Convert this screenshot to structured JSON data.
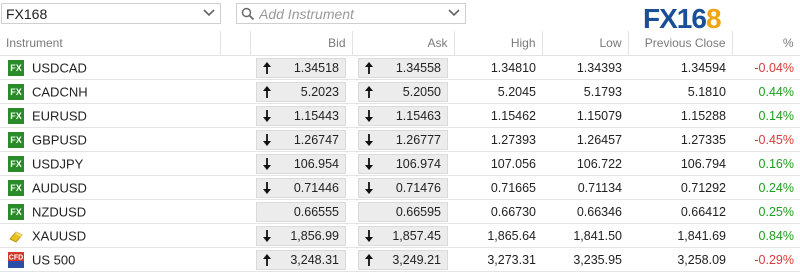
{
  "header": {
    "watchlist": "FX168",
    "add_placeholder": "Add Instrument",
    "logo_main": "FX16",
    "logo_accent": "8"
  },
  "columns": {
    "instrument": "Instrument",
    "bid": "Bid",
    "ask": "Ask",
    "high": "High",
    "low": "Low",
    "prev_close": "Previous Close",
    "pct": "%"
  },
  "rows": [
    {
      "icon": "fx-icon",
      "name": "USDCAD",
      "bid": "1.34518",
      "bid_dir": "up",
      "ask": "1.34558",
      "ask_dir": "up",
      "high": "1.34810",
      "low": "1.34393",
      "prev": "1.34594",
      "pct": "-0.04%"
    },
    {
      "icon": "fx-icon",
      "name": "CADCNH",
      "bid": "5.2023",
      "bid_dir": "up",
      "ask": "5.2050",
      "ask_dir": "up",
      "high": "5.2045",
      "low": "5.1793",
      "prev": "5.1810",
      "pct": "0.44%"
    },
    {
      "icon": "fx-icon",
      "name": "EURUSD",
      "bid": "1.15443",
      "bid_dir": "down",
      "ask": "1.15463",
      "ask_dir": "down",
      "high": "1.15462",
      "low": "1.15079",
      "prev": "1.15288",
      "pct": "0.14%"
    },
    {
      "icon": "fx-icon",
      "name": "GBPUSD",
      "bid": "1.26747",
      "bid_dir": "down",
      "ask": "1.26777",
      "ask_dir": "down",
      "high": "1.27393",
      "low": "1.26457",
      "prev": "1.27335",
      "pct": "-0.45%"
    },
    {
      "icon": "fx-icon",
      "name": "USDJPY",
      "bid": "106.954",
      "bid_dir": "down",
      "ask": "106.974",
      "ask_dir": "down",
      "high": "107.056",
      "low": "106.722",
      "prev": "106.794",
      "pct": "0.16%"
    },
    {
      "icon": "fx-icon",
      "name": "AUDUSD",
      "bid": "0.71446",
      "bid_dir": "down",
      "ask": "0.71476",
      "ask_dir": "down",
      "high": "0.71665",
      "low": "0.71134",
      "prev": "0.71292",
      "pct": "0.24%"
    },
    {
      "icon": "fx-icon",
      "name": "NZDUSD",
      "bid": "0.66555",
      "bid_dir": "none",
      "ask": "0.66595",
      "ask_dir": "none",
      "high": "0.66730",
      "low": "0.66346",
      "prev": "0.66412",
      "pct": "0.25%"
    },
    {
      "icon": "gold-icon",
      "name": "XAUUSD",
      "bid": "1,856.99",
      "bid_dir": "down",
      "ask": "1,857.45",
      "ask_dir": "down",
      "high": "1,865.64",
      "low": "1,841.50",
      "prev": "1,841.69",
      "pct": "0.84%"
    },
    {
      "icon": "cfd-icon",
      "name": "US 500",
      "bid": "3,248.31",
      "bid_dir": "up",
      "ask": "3,249.21",
      "ask_dir": "up",
      "high": "3,273.31",
      "low": "3,235.95",
      "prev": "3,258.09",
      "pct": "-0.29%"
    }
  ],
  "colors": {
    "positive": "#1e9c1e",
    "negative": "#d63a3a",
    "fx_badge": "#2a8a2a",
    "logo_blue": "#1a4f97",
    "logo_orange": "#f1a40f"
  }
}
